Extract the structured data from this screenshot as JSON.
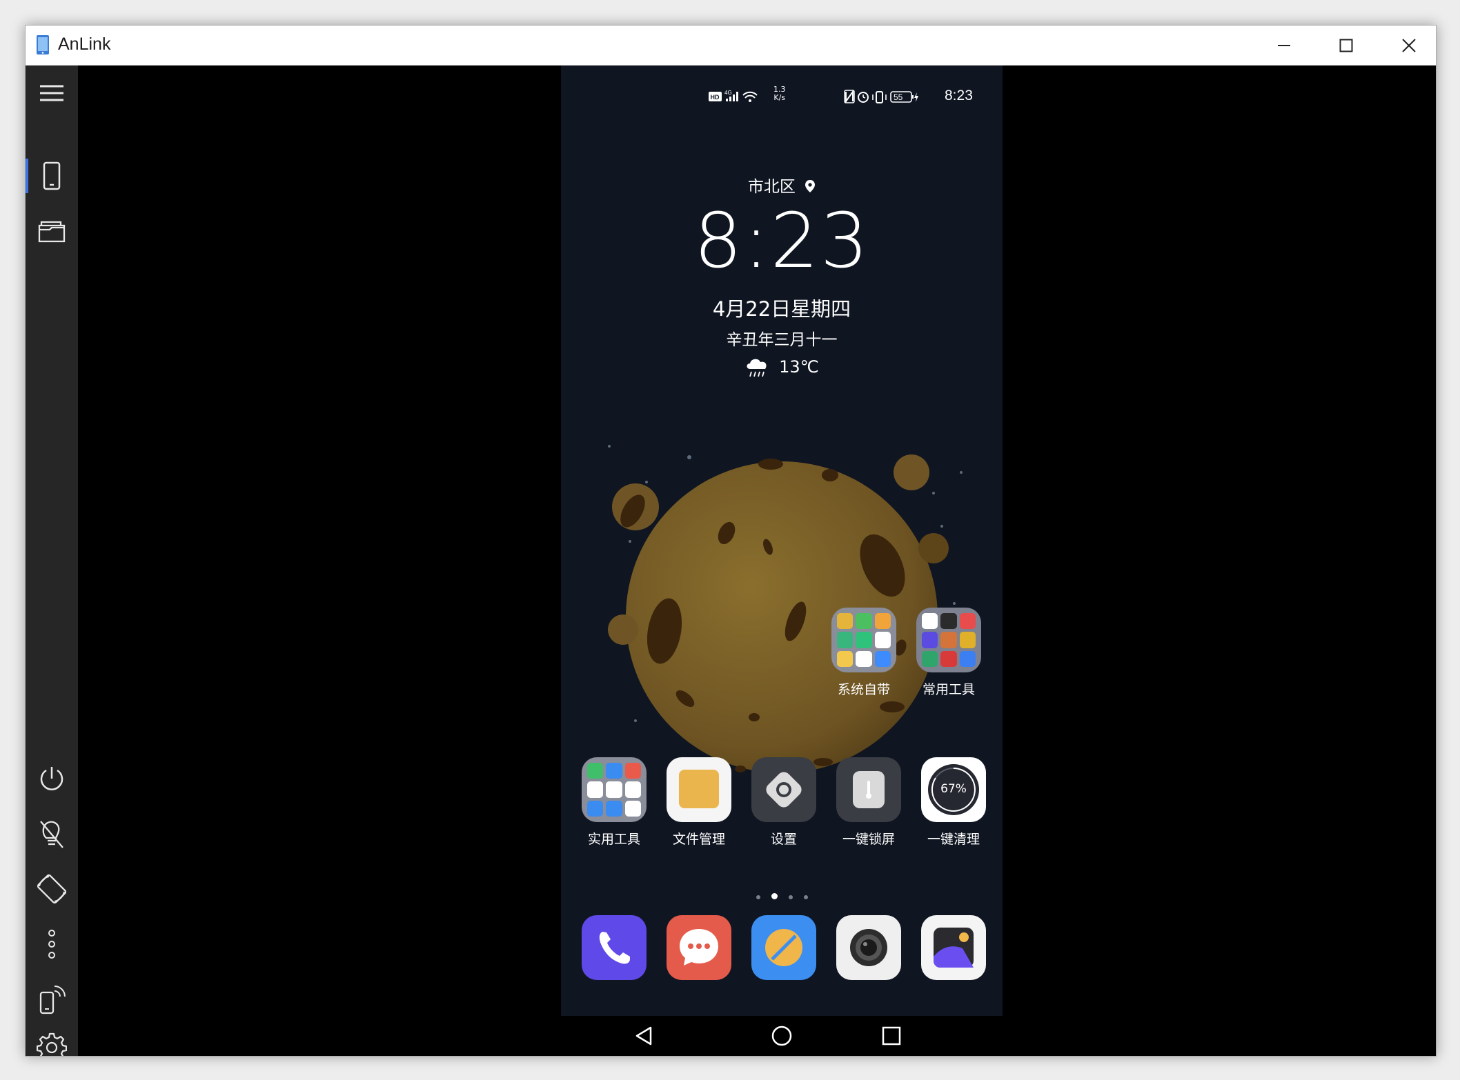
{
  "window": {
    "title": "AnLink"
  },
  "sidebar": {
    "items": [
      {
        "name": "menu"
      },
      {
        "name": "phone-screen",
        "active": true
      },
      {
        "name": "files"
      },
      {
        "name": "power"
      },
      {
        "name": "screen-off"
      },
      {
        "name": "rotate"
      },
      {
        "name": "more"
      },
      {
        "name": "remote-phone"
      },
      {
        "name": "settings"
      }
    ]
  },
  "phone": {
    "status": {
      "speed_top": "1.3",
      "speed_bottom": "K/s",
      "battery": "55",
      "time": "8:23"
    },
    "lockscreen": {
      "location": "市北区",
      "time": "8:23",
      "date": "4月22日星期四",
      "lunar": "辛丑年三月十一",
      "temperature": "13℃"
    },
    "folders": [
      {
        "label": "系统自带"
      },
      {
        "label": "常用工具"
      }
    ],
    "apps": [
      {
        "label": "实用工具"
      },
      {
        "label": "文件管理"
      },
      {
        "label": "设置"
      },
      {
        "label": "一键锁屏"
      },
      {
        "label": "一键清理",
        "badge": "67%"
      }
    ],
    "dock": [
      "phone-app",
      "messages-app",
      "browser-app",
      "camera-app",
      "gallery-app"
    ],
    "page_dots": {
      "count": 4,
      "active": 1
    }
  },
  "colors": {
    "accent": "#3e73e6",
    "phone_bg": "#0f1521",
    "sidebar_bg": "#262626"
  }
}
